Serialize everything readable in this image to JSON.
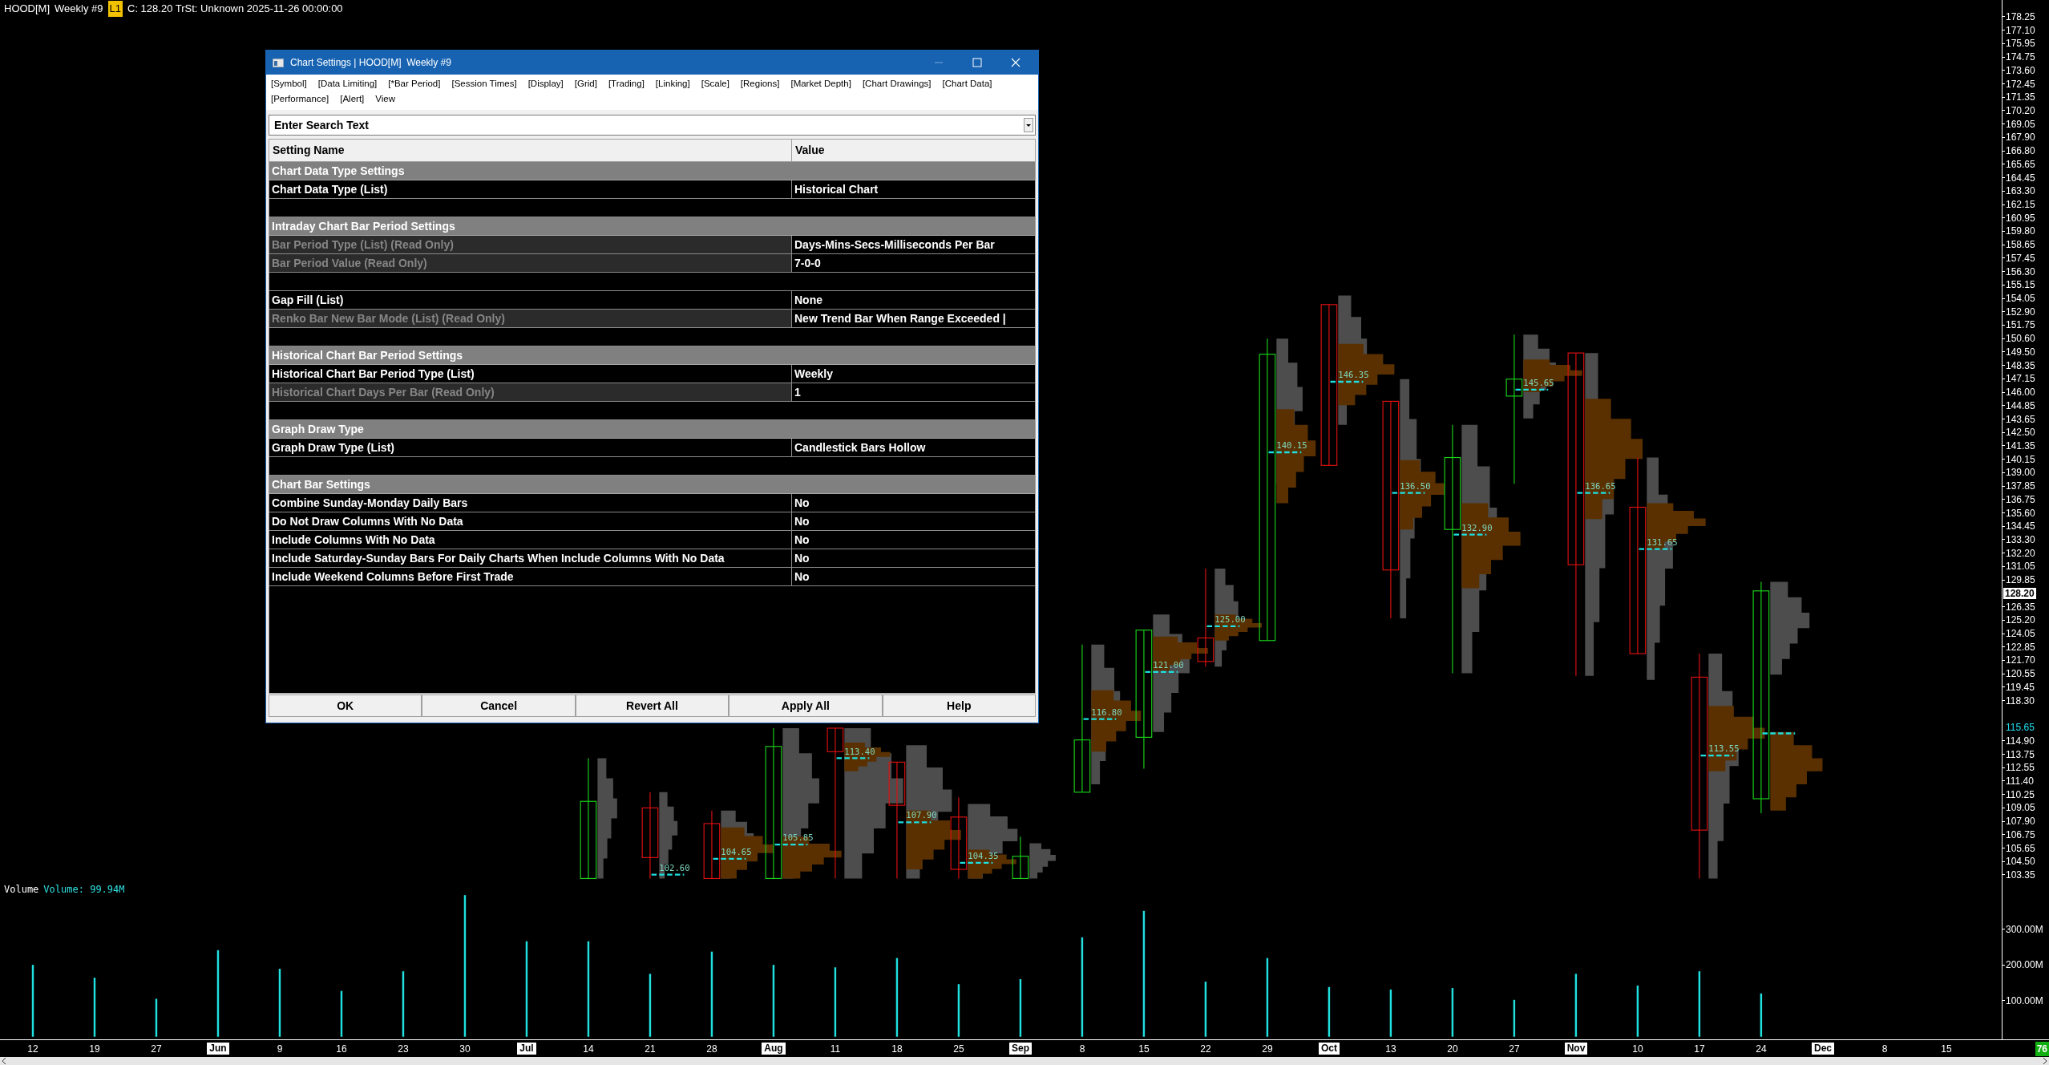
{
  "chart_header": {
    "symbol": "HOOD[M]",
    "period": "Weekly #9",
    "badge": "L1",
    "info": "C: 128.20 TrSt: Unknown 2025-11-26 00:00:00"
  },
  "price_chart": {
    "poc_labels": [
      "102.60",
      "104.65",
      "105.85",
      "113.40",
      "107.90",
      "104.35",
      "116.80",
      "121.00",
      "125.00",
      "140.15",
      "146.35",
      "136.50",
      "132.90",
      "145.65",
      "136.65",
      "131.65",
      "113.55"
    ],
    "price_axis": [
      {
        "kind": "tick",
        "label": "178.25"
      },
      {
        "kind": "tick",
        "label": "177.10"
      },
      {
        "kind": "tick",
        "label": "175.95"
      },
      {
        "kind": "tick",
        "label": "174.75"
      },
      {
        "kind": "tick",
        "label": "173.60"
      },
      {
        "kind": "tick",
        "label": "172.45"
      },
      {
        "kind": "tick",
        "label": "171.35"
      },
      {
        "kind": "tick",
        "label": "170.20"
      },
      {
        "kind": "tick",
        "label": "169.05"
      },
      {
        "kind": "tick",
        "label": "167.90"
      },
      {
        "kind": "tick",
        "label": "166.80"
      },
      {
        "kind": "tick",
        "label": "165.65"
      },
      {
        "kind": "tick",
        "label": "164.45"
      },
      {
        "kind": "tick",
        "label": "163.30"
      },
      {
        "kind": "tick",
        "label": "162.15"
      },
      {
        "kind": "tick",
        "label": "160.95"
      },
      {
        "kind": "tick",
        "label": "159.80"
      },
      {
        "kind": "tick",
        "label": "158.65"
      },
      {
        "kind": "tick",
        "label": "157.45"
      },
      {
        "kind": "tick",
        "label": "156.30"
      },
      {
        "kind": "tick",
        "label": "155.15"
      },
      {
        "kind": "tick",
        "label": "154.05"
      },
      {
        "kind": "tick",
        "label": "152.90"
      },
      {
        "kind": "tick",
        "label": "151.75"
      },
      {
        "kind": "tick",
        "label": "150.60"
      },
      {
        "kind": "tick",
        "label": "149.50"
      },
      {
        "kind": "tick",
        "label": "148.35"
      },
      {
        "kind": "tick",
        "label": "147.15"
      },
      {
        "kind": "tick",
        "label": "146.00"
      },
      {
        "kind": "tick",
        "label": "144.85"
      },
      {
        "kind": "tick",
        "label": "143.65"
      },
      {
        "kind": "tick",
        "label": "142.50"
      },
      {
        "kind": "tick",
        "label": "141.35"
      },
      {
        "kind": "tick",
        "label": "140.15"
      },
      {
        "kind": "tick",
        "label": "139.00"
      },
      {
        "kind": "tick",
        "label": "137.85"
      },
      {
        "kind": "tick",
        "label": "136.75"
      },
      {
        "kind": "tick",
        "label": "135.60"
      },
      {
        "kind": "tick",
        "label": "134.45"
      },
      {
        "kind": "tick",
        "label": "133.30"
      },
      {
        "kind": "tick",
        "label": "132.20"
      },
      {
        "kind": "tick",
        "label": "131.05"
      },
      {
        "kind": "tick",
        "label": "129.85"
      },
      {
        "kind": "current",
        "label": "128.20"
      },
      {
        "kind": "tick",
        "label": "126.35"
      },
      {
        "kind": "tick",
        "label": "125.20"
      },
      {
        "kind": "tick",
        "label": "124.05"
      },
      {
        "kind": "tick",
        "label": "122.85"
      },
      {
        "kind": "tick",
        "label": "121.70"
      },
      {
        "kind": "tick",
        "label": "120.55"
      },
      {
        "kind": "tick",
        "label": "119.45"
      },
      {
        "kind": "tick",
        "label": "118.30"
      },
      {
        "kind": "last",
        "label": "115.65"
      },
      {
        "kind": "tick",
        "label": "114.90"
      },
      {
        "kind": "tick",
        "label": "113.75"
      },
      {
        "kind": "tick",
        "label": "112.55"
      },
      {
        "kind": "tick",
        "label": "111.40"
      },
      {
        "kind": "tick",
        "label": "110.25"
      },
      {
        "kind": "tick",
        "label": "109.05"
      },
      {
        "kind": "tick",
        "label": "107.90"
      },
      {
        "kind": "tick",
        "label": "106.75"
      },
      {
        "kind": "tick",
        "label": "105.65"
      },
      {
        "kind": "tick",
        "label": "104.50"
      },
      {
        "kind": "tick",
        "label": "103.35"
      }
    ]
  },
  "volume_panel": {
    "title": "Volume",
    "reading": "Volume: 99.94M",
    "chart_data": {
      "type": "bar",
      "categories": [
        "12",
        "19",
        "27",
        "Jun",
        "9",
        "16",
        "23",
        "30",
        "Jul",
        "14",
        "21",
        "28",
        "Aug",
        "11",
        "18",
        "25",
        "Sep",
        "8",
        "15",
        "22",
        "29",
        "Oct",
        "13",
        "20",
        "27",
        "Nov",
        "10",
        "17",
        "24",
        "Dec",
        "8",
        "15"
      ],
      "values": [
        201,
        165,
        106,
        242,
        190,
        128,
        183,
        396,
        267,
        267,
        176,
        238,
        201,
        194,
        220,
        147,
        161,
        278,
        352,
        154,
        220,
        139,
        132,
        136,
        103,
        176,
        143,
        183,
        121,
        null,
        null,
        null
      ],
      "ylim": [
        0,
        400
      ],
      "yticks": [
        {
          "value": 300,
          "label": "300.00M"
        },
        {
          "value": 200,
          "label": "200.00M"
        },
        {
          "value": 100,
          "label": "100.00M"
        }
      ]
    }
  },
  "date_axis_highlighted": [
    false,
    false,
    false,
    true,
    false,
    false,
    false,
    false,
    true,
    false,
    false,
    false,
    true,
    false,
    false,
    false,
    true,
    false,
    false,
    false,
    false,
    true,
    false,
    false,
    false,
    true,
    false,
    false,
    false,
    true,
    false,
    false
  ],
  "bar_count": "76",
  "dialog": {
    "title": "Chart Settings | HOOD[M]  Weekly #9",
    "tabs": [
      "[Symbol]",
      "[Data Limiting]",
      "[*Bar Period]",
      "[Session Times]",
      "[Display]",
      "[Grid]",
      "[Trading]",
      "[Linking]",
      "[Scale]",
      "[Regions]",
      "[Market Depth]",
      "[Chart Drawings]",
      "[Chart Data]",
      "[Performance]",
      "[Alert]",
      "View"
    ],
    "search": {
      "placeholder": "Enter Search Text"
    },
    "columns": [
      "Setting Name",
      "Value"
    ],
    "rows": [
      {
        "kind": "section",
        "label": "Chart Data Type Settings"
      },
      {
        "kind": "setting",
        "name": "Chart Data Type (List)",
        "value": "Historical Chart",
        "read_only": false
      },
      {
        "kind": "blank"
      },
      {
        "kind": "section",
        "label": "Intraday Chart Bar Period Settings"
      },
      {
        "kind": "setting",
        "name": "Bar Period Type (List) (Read Only)",
        "value": "Days-Mins-Secs-Milliseconds Per Bar",
        "read_only": true
      },
      {
        "kind": "setting",
        "name": "Bar Period Value (Read Only)",
        "value": "7-0-0",
        "read_only": true
      },
      {
        "kind": "blank"
      },
      {
        "kind": "setting",
        "name": "Gap Fill (List)",
        "value": "None",
        "read_only": false
      },
      {
        "kind": "setting",
        "name": "Renko Bar New Bar Mode (List) (Read Only)",
        "value": "New Trend Bar When Range Exceeded |",
        "read_only": true
      },
      {
        "kind": "blank"
      },
      {
        "kind": "section",
        "label": "Historical Chart Bar Period Settings"
      },
      {
        "kind": "setting",
        "name": "Historical Chart Bar Period Type (List)",
        "value": "Weekly",
        "read_only": false
      },
      {
        "kind": "setting",
        "name": "Historical Chart Days Per Bar (Read Only)",
        "value": "1",
        "read_only": true
      },
      {
        "kind": "blank"
      },
      {
        "kind": "section",
        "label": "Graph Draw Type"
      },
      {
        "kind": "setting",
        "name": "Graph Draw Type (List)",
        "value": "Candlestick Bars Hollow",
        "read_only": false
      },
      {
        "kind": "blank"
      },
      {
        "kind": "section",
        "label": "Chart Bar Settings"
      },
      {
        "kind": "setting",
        "name": "Combine Sunday-Monday Daily Bars",
        "value": "No",
        "read_only": false
      },
      {
        "kind": "setting",
        "name": "Do Not Draw Columns With No Data",
        "value": "No",
        "read_only": false
      },
      {
        "kind": "setting",
        "name": "Include Columns With No Data",
        "value": "No",
        "read_only": false
      },
      {
        "kind": "setting",
        "name": "Include Saturday-Sunday Bars For Daily Charts When Include Columns With No Data",
        "value": "No",
        "read_only": false
      },
      {
        "kind": "setting",
        "name": "Include Weekend Columns Before First Trade",
        "value": "No",
        "read_only": false
      }
    ],
    "buttons": [
      "OK",
      "Cancel",
      "Revert All",
      "Apply All",
      "Help"
    ]
  }
}
